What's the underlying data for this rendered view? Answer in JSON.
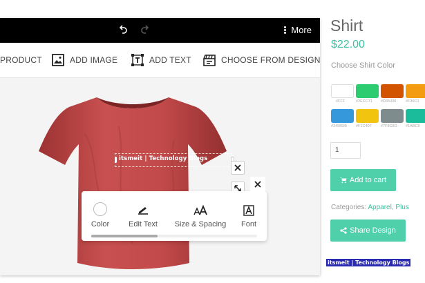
{
  "topbar": {
    "more_label": "More",
    "undo_icon": "undo-icon",
    "redo_icon": "redo-icon"
  },
  "toolbar": {
    "items": [
      {
        "label": "PRODUCT",
        "icon": "product-icon"
      },
      {
        "label": "ADD IMAGE",
        "icon": "image-icon"
      },
      {
        "label": "ADD TEXT",
        "icon": "text-icon"
      },
      {
        "label": "CHOOSE FROM DESIGNS",
        "icon": "designs-icon"
      }
    ]
  },
  "canvas": {
    "shirt_color": "#c34a4a",
    "text_object": "itsmeit | Technology Blogs"
  },
  "text_popup": {
    "tools": [
      {
        "label": "Color",
        "icon": "color-circle-icon"
      },
      {
        "label": "Edit Text",
        "icon": "edit-text-icon"
      },
      {
        "label": "Size & Spacing",
        "icon": "size-spacing-icon"
      },
      {
        "label": "Font",
        "icon": "font-icon"
      }
    ]
  },
  "product": {
    "title": "Shirt",
    "price": "$22.00",
    "color_label": "Choose Shirt Color",
    "swatches": [
      {
        "hex": "#FFF",
        "color": "#ffffff"
      },
      {
        "hex": "#2ECC71",
        "color": "#2ecc71"
      },
      {
        "hex": "#D35400",
        "color": "#d35400"
      },
      {
        "hex": "#F39C1",
        "color": "#f39c12"
      },
      {
        "hex": "#3498DB",
        "color": "#3498db"
      },
      {
        "hex": "#F1C40F",
        "color": "#f1c40f"
      },
      {
        "hex": "#7F8C8D",
        "color": "#7f8c8d"
      },
      {
        "hex": "#1ABC9",
        "color": "#1abc9c"
      }
    ],
    "quantity": "1",
    "add_to_cart_label": "Add to cart",
    "categories_label": "Categories:",
    "categories": [
      "Apparel",
      "Plus"
    ],
    "share_label": "Share Design",
    "brand_tag": "itsmeit | Technology Blogs",
    "accent_color": "#4fcfaa"
  }
}
